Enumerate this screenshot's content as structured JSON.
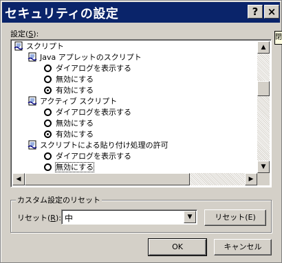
{
  "window": {
    "title": "セキュリティの設定",
    "help_glyph": "?",
    "close_glyph": "×",
    "side_tip": "閉"
  },
  "settings": {
    "label_prefix": "設定(",
    "label_key": "S",
    "label_suffix": "):"
  },
  "tree": [
    {
      "kind": "folder",
      "text": "スクリプト"
    },
    {
      "kind": "folder",
      "text": "Java アプレットのスクリプト"
    },
    {
      "kind": "radio",
      "text": "ダイアログを表示する",
      "checked": false
    },
    {
      "kind": "radio",
      "text": "無効にする",
      "checked": false
    },
    {
      "kind": "radio",
      "text": "有効にする",
      "checked": true
    },
    {
      "kind": "folder",
      "text": "アクティブ スクリプト"
    },
    {
      "kind": "radio",
      "text": "ダイアログを表示する",
      "checked": false
    },
    {
      "kind": "radio",
      "text": "無効にする",
      "checked": false
    },
    {
      "kind": "radio",
      "text": "有効にする",
      "checked": true
    },
    {
      "kind": "folder",
      "text": "スクリプトによる貼り付け処理の許可"
    },
    {
      "kind": "radio",
      "text": "ダイアログを表示する",
      "checked": false
    },
    {
      "kind": "radio",
      "text": "無効にする",
      "checked": false
    }
  ],
  "scroll": {
    "up": "▲",
    "down": "▼",
    "left": "◀",
    "right": "▶"
  },
  "reset_group": {
    "title": "カスタム設定のリセット",
    "label_prefix": "リセット(",
    "label_key": "R",
    "label_suffix": "):",
    "selected": "中",
    "combo_arrow": "▼",
    "reset_button": "リセット(E)"
  },
  "buttons": {
    "ok": "OK",
    "cancel": "キャンセル"
  },
  "colors": {
    "face": "#d4d0c8",
    "titlebar": "#0a246a"
  }
}
